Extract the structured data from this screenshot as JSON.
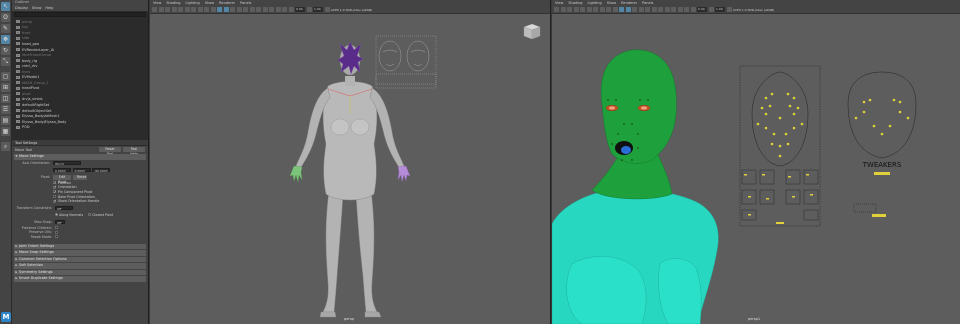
{
  "outliner": {
    "title": "Outliner",
    "menu": [
      "Display",
      "Show",
      "Help"
    ],
    "items": [
      {
        "label": "persp",
        "dim": true
      },
      {
        "label": "top",
        "dim": true
      },
      {
        "label": "front",
        "dim": true
      },
      {
        "label": "side",
        "dim": true
      },
      {
        "label": "head_geo",
        "dim": false
      },
      {
        "label": "EVRenderLayer_IA",
        "dim": false
      },
      {
        "label": "faceFrameGroup",
        "dim": true
      },
      {
        "label": "body_rig",
        "dim": false
      },
      {
        "label": "cntrl_drv",
        "dim": false
      },
      {
        "label": "eyes",
        "dim": true
      },
      {
        "label": "EVModel1",
        "dim": false
      },
      {
        "label": "MASH_Group_1",
        "dim": true
      },
      {
        "label": "headPivot",
        "dim": false
      },
      {
        "label": "pivot",
        "dim": true
      },
      {
        "label": "drvjs_smbls",
        "dim": false
      },
      {
        "label": "defaultRightSet",
        "dim": false
      },
      {
        "label": "defaultObjectSet",
        "dim": false
      },
      {
        "label": "Elyssa_BodyJatMesh1",
        "dim": false
      },
      {
        "label": "Elyssa_BodyJElyssa_Body",
        "dim": false
      },
      {
        "label": "POD",
        "dim": false
      }
    ]
  },
  "tool_settings": {
    "title": "Tool Settings",
    "tool_name": "Move Tool",
    "reset_label": "Reset Tool",
    "help_label": "Tool Help",
    "sections": {
      "move_settings": "Move Settings",
      "joint_orient": "Joint Orient Settings",
      "move_snap": "Move Snap Settings",
      "common_sel": "Common Selection Options",
      "soft_sel": "Soft Selection",
      "symmetry": "Symmetry Settings",
      "smart_dup": "Smart Duplicate Settings"
    },
    "axis_orientation_label": "Axis Orientation:",
    "axis_orientation_value": "World",
    "fields": [
      "0.0000",
      "0.0000",
      "-90.0000"
    ],
    "pivot_label": "Pivot:",
    "edit_pivot_label": "Edit Pivot",
    "reset_pivot_label": "Reset",
    "checks": [
      {
        "label": "Position",
        "on": true
      },
      {
        "label": "Orientation",
        "on": true
      },
      {
        "label": "Pin Component Pivot",
        "on": true
      },
      {
        "label": "Bake Pivot Orientation",
        "on": false
      },
      {
        "label": "Show Orientation Handle",
        "on": true
      }
    ],
    "transform_constraint_label": "Transform Constraint:",
    "transform_constraint_value": "Off",
    "along_normals_label": "Along Normals",
    "closest_point_label": "Closest Point",
    "step_snap_label": "Step Snap:",
    "step_snap_value": "Off",
    "preserve_children_label": "Preserve Children:",
    "preserve_uvs_label": "Preserve UVs:",
    "tweak_mode_label": "Tweak Mode:"
  },
  "left_viewport": {
    "menu": [
      "View",
      "Shading",
      "Lighting",
      "Show",
      "Renderer",
      "Panels"
    ],
    "near_value": "0.00",
    "far_value": "1.00",
    "resolution_label": "ACES 1.0 SDR-video (sRGB)",
    "camera_label": "persp"
  },
  "right_viewport": {
    "menu": [
      "View",
      "Shading",
      "Lighting",
      "Show",
      "Renderer",
      "Panels"
    ],
    "near_value": "0.00",
    "far_value": "1.00",
    "resolution_label": "ACES 1.0 SDR-video (sRGB)",
    "camera_label": "persp1",
    "tweakers_label": "TWEAKERS"
  },
  "colors": {
    "skin_green": "#1ea03c",
    "body_cyan": "#27d7bf",
    "viewport_bg": "#5d5d5d",
    "accent_blue": "#5285a6"
  }
}
